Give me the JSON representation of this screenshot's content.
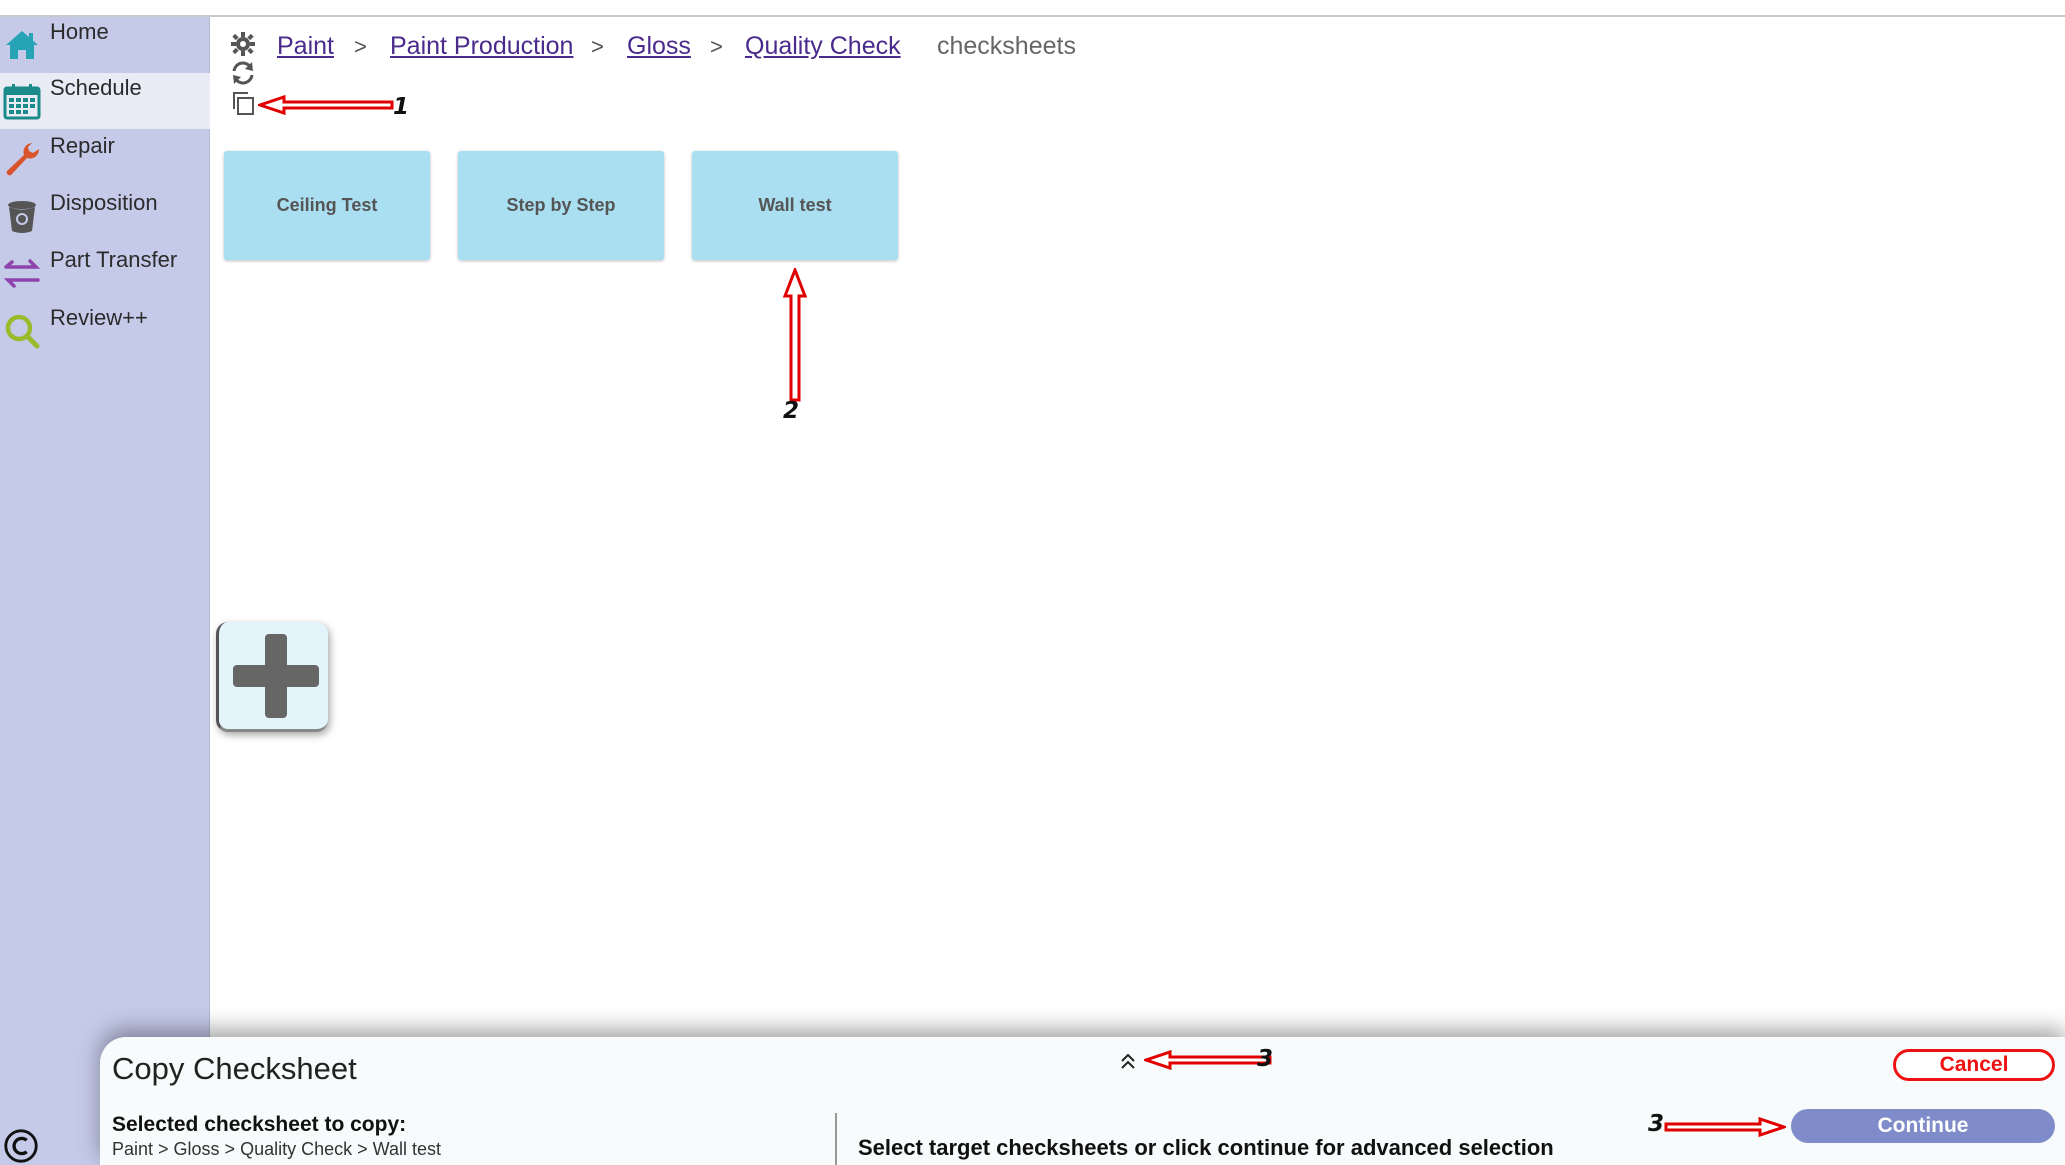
{
  "sidebar": {
    "items": [
      {
        "label": "Home",
        "icon": "home-icon",
        "color": "#26a3b5"
      },
      {
        "label": "Schedule",
        "icon": "calendar-icon",
        "color": "#1a8a8a",
        "active": true
      },
      {
        "label": "Repair",
        "icon": "wrench-icon",
        "color": "#d9542b"
      },
      {
        "label": "Disposition",
        "icon": "trash-icon",
        "color": "#555555"
      },
      {
        "label": "Part Transfer",
        "icon": "transfer-arrows-icon",
        "color": "#8e44ad"
      },
      {
        "label": "Review++",
        "icon": "magnifier-icon",
        "color": "#9bbb2e"
      }
    ]
  },
  "toolbar": {
    "icons": [
      "gear-icon",
      "refresh-icon",
      "copy-icon"
    ]
  },
  "breadcrumb": {
    "items": [
      "Paint",
      "Paint Production",
      "Gloss",
      "Quality Check"
    ],
    "separator": ">",
    "current": "checksheets"
  },
  "tiles": [
    {
      "label": "Ceiling Test"
    },
    {
      "label": "Step by Step"
    },
    {
      "label": "Wall test"
    }
  ],
  "annotations": {
    "one": "1",
    "two": "2",
    "three_a": "3",
    "three_b": "3",
    "color": "#e00000"
  },
  "copy_panel": {
    "title": "Copy Checksheet",
    "selected_label": "Selected checksheet to copy:",
    "selected_path": "Paint > Gloss > Quality Check > Wall test",
    "target_text": "Select target checksheets or click continue for advanced selection",
    "cancel_label": "Cancel",
    "continue_label": "Continue"
  }
}
